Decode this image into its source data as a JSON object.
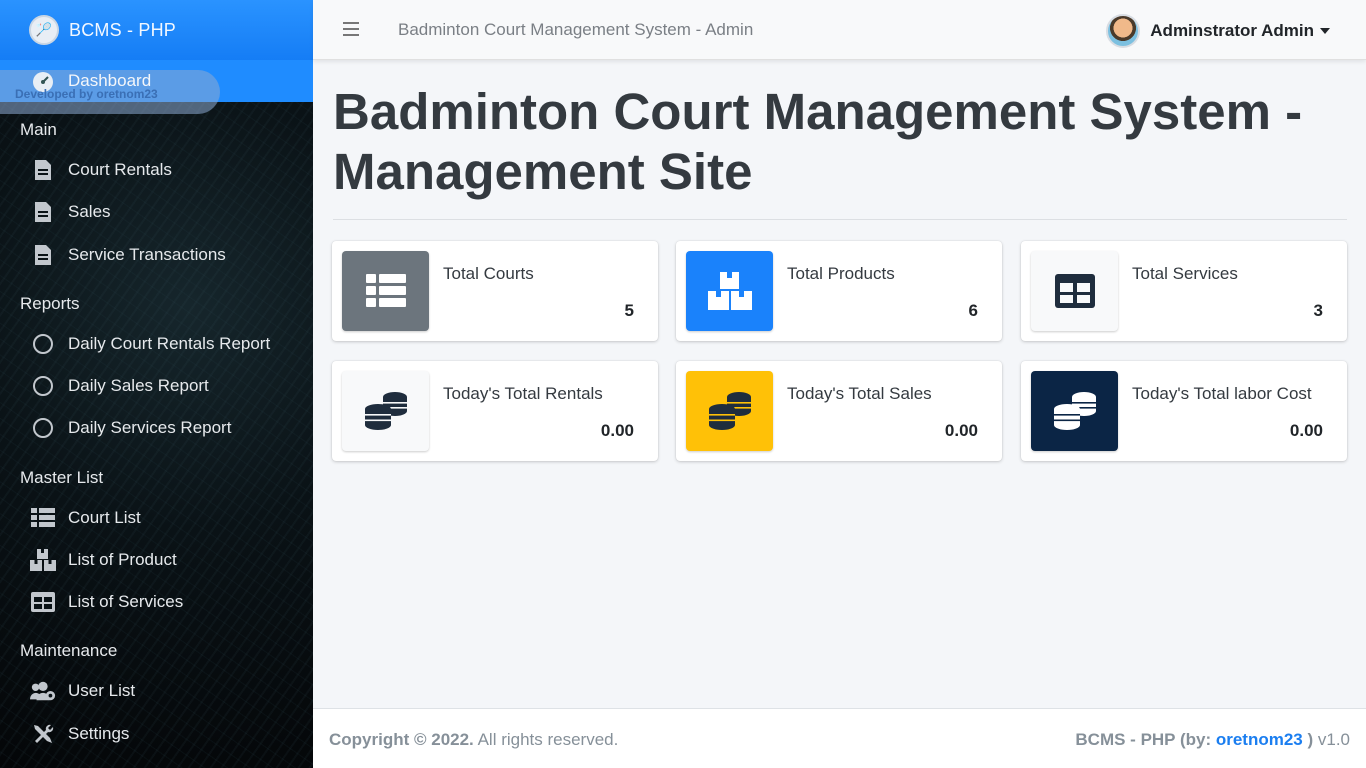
{
  "brand": {
    "name": "BCMS - PHP"
  },
  "sidebar": {
    "active": {
      "label": "Dashboard",
      "badge": "Developed by oretnom23"
    },
    "sections": {
      "main": "Main",
      "reports": "Reports",
      "master": "Master List",
      "maintenance": "Maintenance"
    },
    "items": {
      "court_rentals": "Court Rentals",
      "sales": "Sales",
      "service_transactions": "Service Transactions",
      "daily_court_rentals": "Daily Court Rentals Report",
      "daily_sales": "Daily Sales Report",
      "daily_services": "Daily Services Report",
      "court_list": "Court List",
      "product_list": "List of Product",
      "services_list": "List of Services",
      "user_list": "User List",
      "settings": "Settings"
    }
  },
  "topbar": {
    "title": "Badminton Court Management System - Admin",
    "user": "Adminstrator Admin"
  },
  "main": {
    "title": "Badminton Court Management System - Management Site",
    "cards": {
      "courts": {
        "label": "Total Courts",
        "value": "5"
      },
      "products": {
        "label": "Total Products",
        "value": "6"
      },
      "services": {
        "label": "Total Services",
        "value": "3"
      },
      "rentals": {
        "label": "Today's Total Rentals",
        "value": "0.00"
      },
      "sales": {
        "label": "Today's Total Sales",
        "value": "0.00"
      },
      "labor": {
        "label": "Today's Total labor Cost",
        "value": "0.00"
      }
    }
  },
  "footer": {
    "copyright_bold": "Copyright © 2022.",
    "copyright_rest": " All rights reserved.",
    "right_bold": "BCMS - PHP (by: ",
    "right_link": "oretnom23",
    "right_bold_end": " )",
    "version": " v1.0"
  },
  "colors": {
    "brand_blue": "#1f8cff",
    "gray_card": "#6c757d",
    "blue_card": "#007bff",
    "yellow_card": "#ffc107",
    "navy_card": "#001f3f"
  }
}
